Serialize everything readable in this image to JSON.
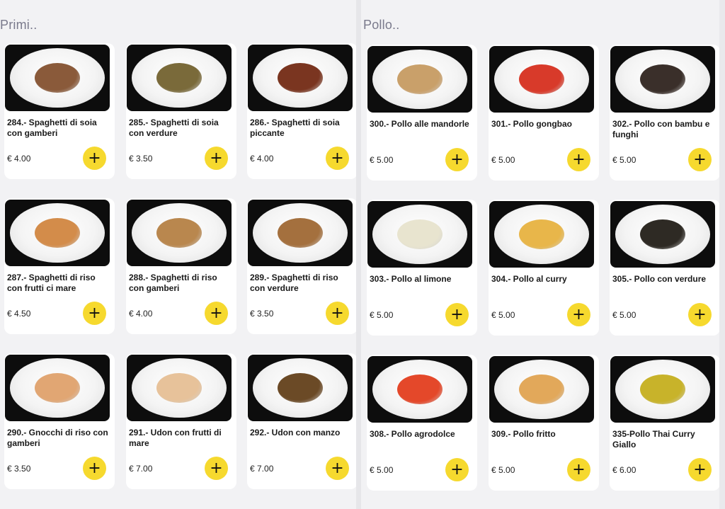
{
  "sections": [
    {
      "title": "Primi..",
      "items": [
        {
          "name": "284.- Spaghetti di soia con gamberi",
          "price": "€ 4.00",
          "food_color": "#8a5a3a"
        },
        {
          "name": "285.- Spaghetti di soia con verdure",
          "price": "€ 3.50",
          "food_color": "#7a6a3a"
        },
        {
          "name": "286.- Spaghetti di soia piccante",
          "price": "€ 4.00",
          "food_color": "#7a3520"
        },
        {
          "name": "287.- Spaghetti di riso con frutti ci mare",
          "price": "€ 4.50",
          "food_color": "#d38c4a"
        },
        {
          "name": "288.- Spaghetti di riso con gamberi",
          "price": "€ 4.00",
          "food_color": "#b9874e"
        },
        {
          "name": "289.- Spaghetti di riso con verdure",
          "price": "€ 3.50",
          "food_color": "#a4703e"
        },
        {
          "name": "290.- Gnocchi di riso con gamberi",
          "price": "€ 3.50",
          "food_color": "#e1a673"
        },
        {
          "name": "291.- Udon con frutti di mare",
          "price": "€ 7.00",
          "food_color": "#e7c29a"
        },
        {
          "name": "292.- Udon con manzo",
          "price": "€ 7.00",
          "food_color": "#6b4a26"
        }
      ]
    },
    {
      "title": "Pollo..",
      "items": [
        {
          "name": "300.- Pollo alle mandorle",
          "price": "€ 5.00",
          "food_color": "#c9a06a"
        },
        {
          "name": "301.- Pollo gongbao",
          "price": "€ 5.00",
          "food_color": "#d83a2a"
        },
        {
          "name": "302.- Pollo con bambu e funghi",
          "price": "€ 5.00",
          "food_color": "#3a2f2a"
        },
        {
          "name": "303.- Pollo al limone",
          "price": "€ 5.00",
          "food_color": "#e8e4cf"
        },
        {
          "name": "304.- Pollo al curry",
          "price": "€ 5.00",
          "food_color": "#e8b64a"
        },
        {
          "name": "305.- Pollo con verdure",
          "price": "€ 5.00",
          "food_color": "#2e2a24"
        },
        {
          "name": "308.- Pollo agrodolce",
          "price": "€ 5.00",
          "food_color": "#e4482a"
        },
        {
          "name": "309.- Pollo fritto",
          "price": "€ 5.00",
          "food_color": "#e2a85a"
        },
        {
          "name": "335-Pollo Thai Curry Giallo",
          "price": "€ 6.00",
          "food_color": "#c8b32a"
        }
      ]
    }
  ],
  "add_label": "+"
}
